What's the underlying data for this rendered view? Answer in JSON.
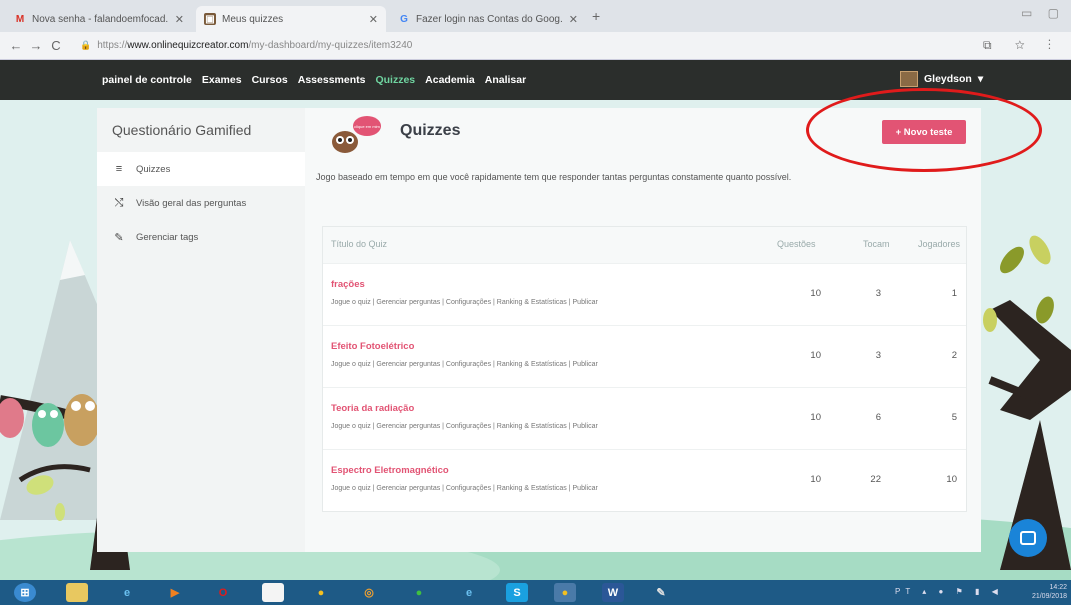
{
  "browser": {
    "tabs": [
      {
        "title": "Nova senha - falandoemfocad...",
        "icon": "gmail-icon",
        "active": false
      },
      {
        "title": "Meus quizzes",
        "icon": "quiz-icon",
        "active": true
      },
      {
        "title": "Fazer login nas Contas do Goog...",
        "icon": "google-icon",
        "active": false
      }
    ],
    "url_scheme": "https://",
    "url_host": "www.onlinequizcreator.com",
    "url_path": "/my-dashboard/my-quizzes/item3240"
  },
  "sitenav": {
    "links": [
      "painel de controle",
      "Exames",
      "Cursos",
      "Assessments",
      "Quizzes",
      "Academia",
      "Analisar"
    ],
    "active": "Quizzes",
    "user": "Gleydson",
    "user_caret": "▾"
  },
  "sidebar": {
    "title": "Questionário Gamified",
    "items": [
      {
        "label": "Quizzes",
        "icon": "list-icon"
      },
      {
        "label": "Visão geral das perguntas",
        "icon": "shuffle-icon"
      },
      {
        "label": "Gerenciar tags",
        "icon": "tag-icon"
      }
    ]
  },
  "main": {
    "title": "Quizzes",
    "mascot_text": "clique em mim",
    "new_button": "+ Novo teste",
    "description": "Jogo baseado em tempo em que você rapidamente tem que responder tantas perguntas constamente quanto possível.",
    "columns": [
      "Título do Quiz",
      "Questões",
      "Tocam",
      "Jogadores"
    ],
    "action_links": "Jogue o quiz | Gerenciar perguntas | Configurações | Ranking & Estatísticas | Publicar",
    "rows": [
      {
        "name": "frações",
        "questoes": "10",
        "tocam": "3",
        "jogadores": "1"
      },
      {
        "name": "Efeito Fotoelétrico",
        "questoes": "10",
        "tocam": "3",
        "jogadores": "2"
      },
      {
        "name": "Teoria da radiação",
        "questoes": "10",
        "tocam": "6",
        "jogadores": "5"
      },
      {
        "name": "Espectro Eletromagnético",
        "questoes": "10",
        "tocam": "22",
        "jogadores": "10"
      }
    ]
  },
  "taskbar": {
    "lang": "PT",
    "time": "14:22",
    "date": "21/09/2018"
  },
  "colors": {
    "accent": "#e25474",
    "nav_bg": "#2b2e2c",
    "active_link": "#6fd4a0",
    "annotation": "#e01b1b"
  }
}
